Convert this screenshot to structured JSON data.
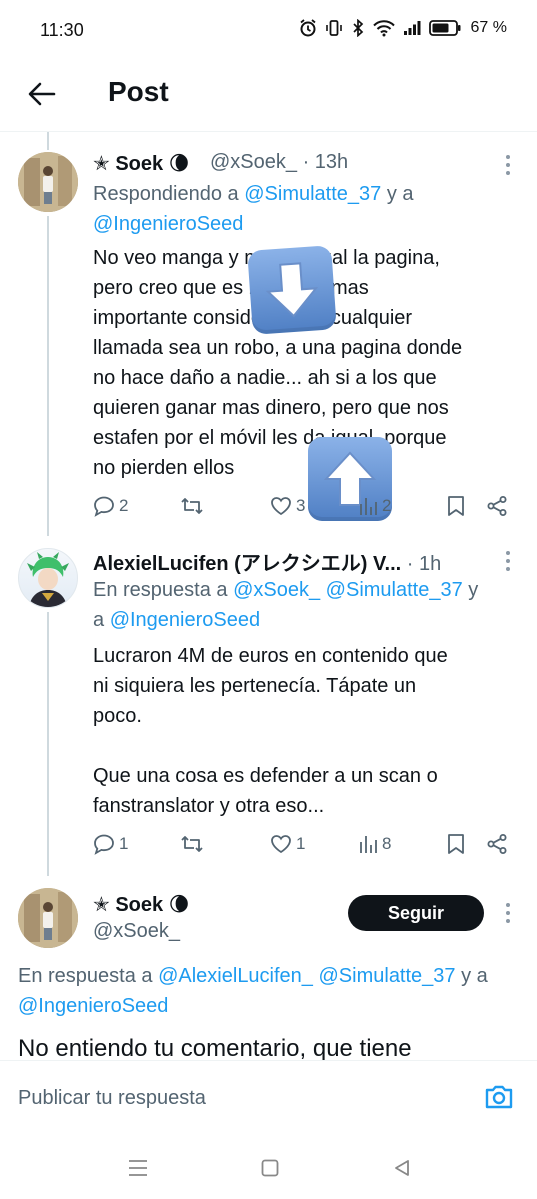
{
  "status_bar": {
    "time": "11:30",
    "battery_percent": "67 %"
  },
  "header": {
    "title": "Post"
  },
  "tweets": [
    {
      "author": "✭ Soek 🌘",
      "handle": "@xSoek_",
      "time": "· 13h",
      "reply_prefix": "Respondiendo a ",
      "reply_mention_1": "@Simulatte_37",
      "reply_join": " y a",
      "reply_mention_2": "@IngenieroSeed",
      "body": "No veo manga y me da igual la pagina,\npero creo que es bastante mas\nimportante considerar que cualquier\nllamada sea un robo, a una pagina donde\nno hace daño a nadie... ah si a los que\nquieren ganar mas dinero, pero que nos\nestafen por el móvil les da igual, porque\nno pierden ellos",
      "replies": "2",
      "retweets": "",
      "likes": "3",
      "views": "2"
    },
    {
      "author": "AlexielLucifen (アレクシエル) V...",
      "time": "· 1h",
      "reply_prefix": "En respuesta a ",
      "reply_mention_1": "@xSoek_",
      "reply_mention_2": "@Simulatte_37",
      "reply_join": " y",
      "reply_join_2": "a ",
      "reply_mention_3": "@IngenieroSeed",
      "body": "Lucraron 4M de euros en contenido que\nni siquiera les pertenecía. Tápate un\npoco.\n\nQue una cosa es defender a un scan o\nfanstranslator y otra eso...",
      "replies": "1",
      "retweets": "",
      "likes": "1",
      "views": "8"
    },
    {
      "author": "✭ Soek 🌘",
      "handle": "@xSoek_",
      "follow_label": "Seguir",
      "reply_prefix": "En respuesta a ",
      "reply_mention_1": "@AlexielLucifen_",
      "reply_mention_2": "@Simulatte_37",
      "reply_join": " y a",
      "reply_mention_3": "@IngenieroSeed",
      "body": "No entiendo tu comentario, que tiene"
    }
  ],
  "composer": {
    "placeholder": "Publicar tu respuesta"
  },
  "colors": {
    "accent": "#1d9bf0",
    "text": "#0f1419",
    "muted": "#536471",
    "follow_bg": "#0f1419"
  },
  "icons": [
    "back-arrow-icon",
    "reply-icon",
    "retweet-icon",
    "like-icon",
    "views-icon",
    "bookmark-icon",
    "share-icon",
    "camera-icon",
    "down-arrow-emoji",
    "up-arrow-emoji"
  ]
}
